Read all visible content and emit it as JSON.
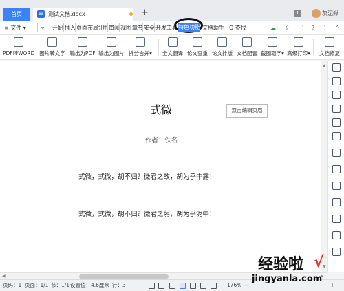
{
  "tabs": {
    "home": "首页",
    "doc": "测试文档.docx",
    "new": "+",
    "badge": "1",
    "user": "灰泥鳅"
  },
  "menu": {
    "file": "≡ 文件 ▾",
    "items": [
      "开始",
      "插入",
      "页面布局",
      "引用",
      "审阅",
      "视图",
      "章节",
      "安全",
      "开发工具",
      "特色功能",
      "文档助手"
    ],
    "search": "Q 查找",
    "active": "特色功能",
    "help": "?",
    "more": "⋮",
    "collapse": "^"
  },
  "ribbon": [
    "PDF转WORD",
    "图片转文字",
    "输出为PDF",
    "输出为图片",
    "拆分合并▾",
    "全文翻译",
    "论文查重",
    "论文排版",
    "文档配音",
    "截图取字▾",
    "高级打印▾",
    "文档修复"
  ],
  "document": {
    "title": "式微",
    "button": "双击编辑页眉",
    "author": "作者：佚名",
    "line1": "式微，式微，胡不归？微君之故，胡为乎中露！",
    "line2": "式微，式微，胡不归？微君之躬，胡为乎泥中！"
  },
  "status": {
    "page": "页码：1",
    "pages": "页面：1/1",
    "section": "节：1/1",
    "setting": "设置值：4.6厘米",
    "row": "行：3",
    "zoom": "176%",
    "zoom_minus": "—",
    "zoom_plus": "+"
  },
  "watermark": {
    "logo": "经验啦",
    "check": "√",
    "url": "jingyanla.com"
  },
  "colors": {
    "accent": "#3b82f6",
    "tab_dot": "#f5a623"
  }
}
